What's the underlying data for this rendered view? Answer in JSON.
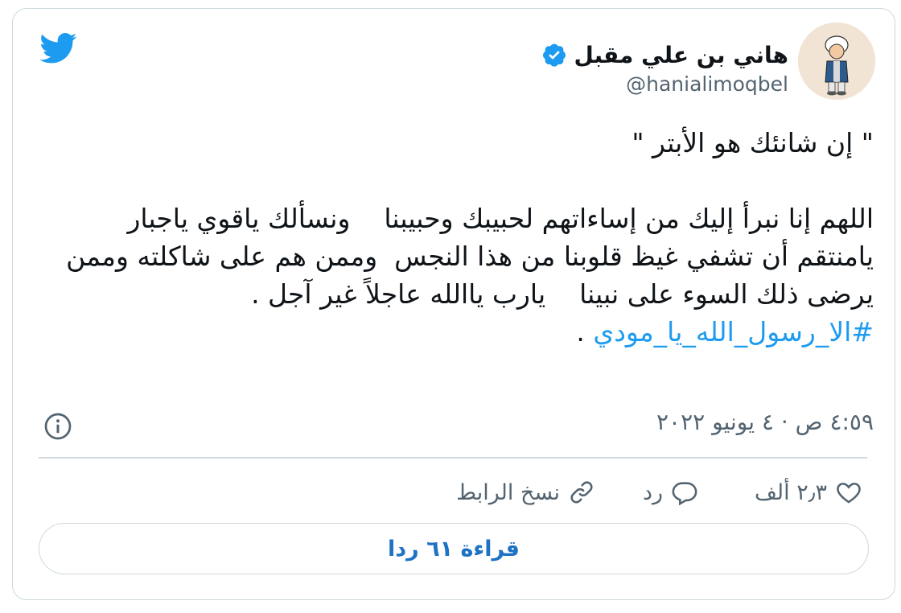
{
  "brand": {
    "accent": "#1d9bf0",
    "text": "#0f1419",
    "muted": "#536471",
    "border": "#cfd9de"
  },
  "author": {
    "display_name": "هاني بن علي مقبل",
    "handle": "@hanialimoqbel",
    "verified": true
  },
  "tweet": {
    "line1": "\" إن شانئك هو الأبتر \"",
    "body": "اللهم إنا نبرأ إليك من إساءاتهم لحبيبك وحبيبنا    ونسألك ياقوي ياجبار يامنتقم أن تشفي غيظ قلوبنا من هذا النجس  وممن هم على شاكلته وممن يرضى ذلك السوء على نبينا    يارب ياالله عاجلاً غير آجل .",
    "hashtag": "#الا_رسول_الله_يا_مودي",
    "hashtag_suffix": " ."
  },
  "timestamp": "٤:٥٩ ص · ٤ يونيو ٢٠٢٢",
  "actions": {
    "like_count": "٢٫٣ ألف",
    "reply_label": "رد",
    "copy_link_label": "نسخ الرابط"
  },
  "read_replies_label": "قراءة ٦١ ردا",
  "icons": {
    "logo": "twitter-bird-icon",
    "verified": "verified-badge-icon",
    "info": "info-icon",
    "like": "heart-icon",
    "reply": "speech-bubble-icon",
    "copy": "link-icon"
  }
}
